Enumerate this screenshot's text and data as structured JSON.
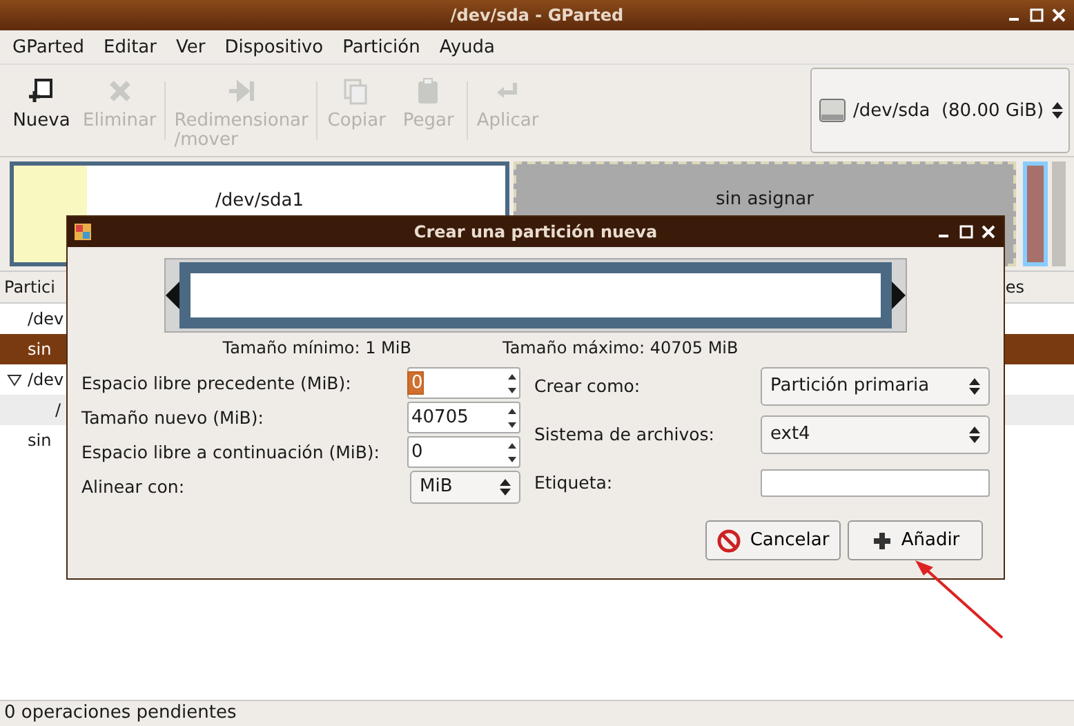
{
  "window": {
    "title": "/dev/sda - GParted"
  },
  "menu": [
    "GParted",
    "Editar",
    "Ver",
    "Dispositivo",
    "Partición",
    "Ayuda"
  ],
  "toolbar": [
    {
      "kind": "new",
      "label": "Nueva",
      "disabled": false
    },
    {
      "kind": "delete",
      "label": "Eliminar",
      "disabled": true
    },
    {
      "kind": "resize",
      "label": "Redimensionar\n/mover",
      "disabled": true
    },
    {
      "kind": "copy",
      "label": "Copiar",
      "disabled": true
    },
    {
      "kind": "paste",
      "label": "Pegar",
      "disabled": true
    },
    {
      "kind": "apply",
      "label": "Aplicar",
      "disabled": true
    }
  ],
  "device": {
    "value": "/dev/sda  (80.00 GiB)"
  },
  "disk_map": [
    {
      "kind": "partition",
      "label": "/dev/sda1",
      "level": 0.15
    },
    {
      "kind": "unallocated",
      "label": "sin asignar"
    }
  ],
  "table": {
    "columns": [
      "Partici",
      "es"
    ],
    "rows": [
      {
        "text": "/dev",
        "expander": false,
        "selected": false
      },
      {
        "text": "sin",
        "expander": false,
        "selected": true
      },
      {
        "text": "/dev",
        "expander": true,
        "selected": false,
        "children": [
          {
            "text": "/",
            "selected": false
          }
        ]
      },
      {
        "text": "sin",
        "expander": false,
        "selected": false
      }
    ]
  },
  "status_bar": "0 operaciones pendientes",
  "dialog": {
    "title": "Crear una partición nueva",
    "min_label": "Tamaño mínimo: 1 MiB",
    "max_label": "Tamaño máximo: 40705 MiB",
    "left_fields": [
      {
        "kind": "spin",
        "label": "Espacio libre precedente (MiB):",
        "value": "0",
        "focused": true
      },
      {
        "kind": "spin",
        "label": "Tamaño nuevo (MiB):",
        "value": "40705",
        "focused": false
      },
      {
        "kind": "spin",
        "label": "Espacio libre a continuación (MiB):",
        "value": "0",
        "focused": false
      },
      {
        "kind": "combo",
        "label": "Alinear con:",
        "value": "MiB"
      }
    ],
    "right_fields": [
      {
        "kind": "combo",
        "label": "Crear como:",
        "value": "Partición primaria"
      },
      {
        "kind": "combo",
        "label": "Sistema de archivos:",
        "value": "ext4"
      },
      {
        "kind": "text",
        "label": "Etiqueta:"
      }
    ],
    "buttons": [
      {
        "kind": "cancel",
        "label": "Cancelar"
      },
      {
        "kind": "add",
        "label": "Añadir"
      }
    ]
  }
}
